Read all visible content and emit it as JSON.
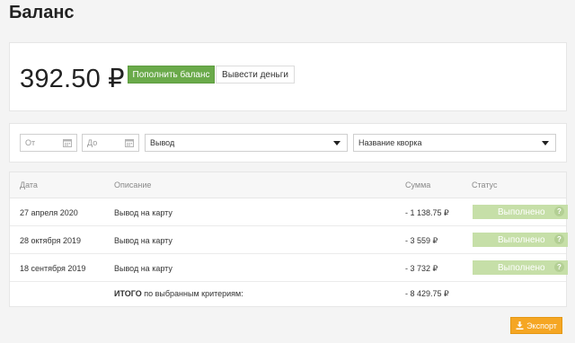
{
  "page": {
    "title": "Баланс"
  },
  "balance": {
    "amount": "392.50 ₽",
    "topup_label": "Пополнить баланс",
    "withdraw_label": "Вывести деньги"
  },
  "filters": {
    "from_placeholder": "От",
    "to_placeholder": "До",
    "type_value": "Вывод",
    "kwork_value": "Название кворка"
  },
  "table": {
    "headers": {
      "date": "Дата",
      "description": "Описание",
      "amount": "Сумма",
      "status": "Статус"
    },
    "rows": [
      {
        "date": "27 апреля 2020",
        "description": "Вывод на карту",
        "amount": "- 1 138.75 ₽",
        "status": "Выполнено"
      },
      {
        "date": "28 октября 2019",
        "description": "Вывод на карту",
        "amount": "- 3 559 ₽",
        "status": "Выполнено"
      },
      {
        "date": "18 сентября 2019",
        "description": "Вывод на карту",
        "amount": "- 3 732 ₽",
        "status": "Выполнено"
      }
    ],
    "total": {
      "label_bold": "ИТОГО",
      "label_rest": " по выбранным критериям:",
      "amount": "- 8 429.75 ₽"
    },
    "help_glyph": "?"
  },
  "export": {
    "label": "Экспорт"
  },
  "colors": {
    "primary_green": "#6aaa4a",
    "status_green": "#c6dfa8",
    "export_orange": "#f5a623"
  },
  "icons": {
    "calendar": "calendar-icon",
    "caret": "caret-down-icon",
    "help": "help-icon",
    "download": "download-icon"
  }
}
